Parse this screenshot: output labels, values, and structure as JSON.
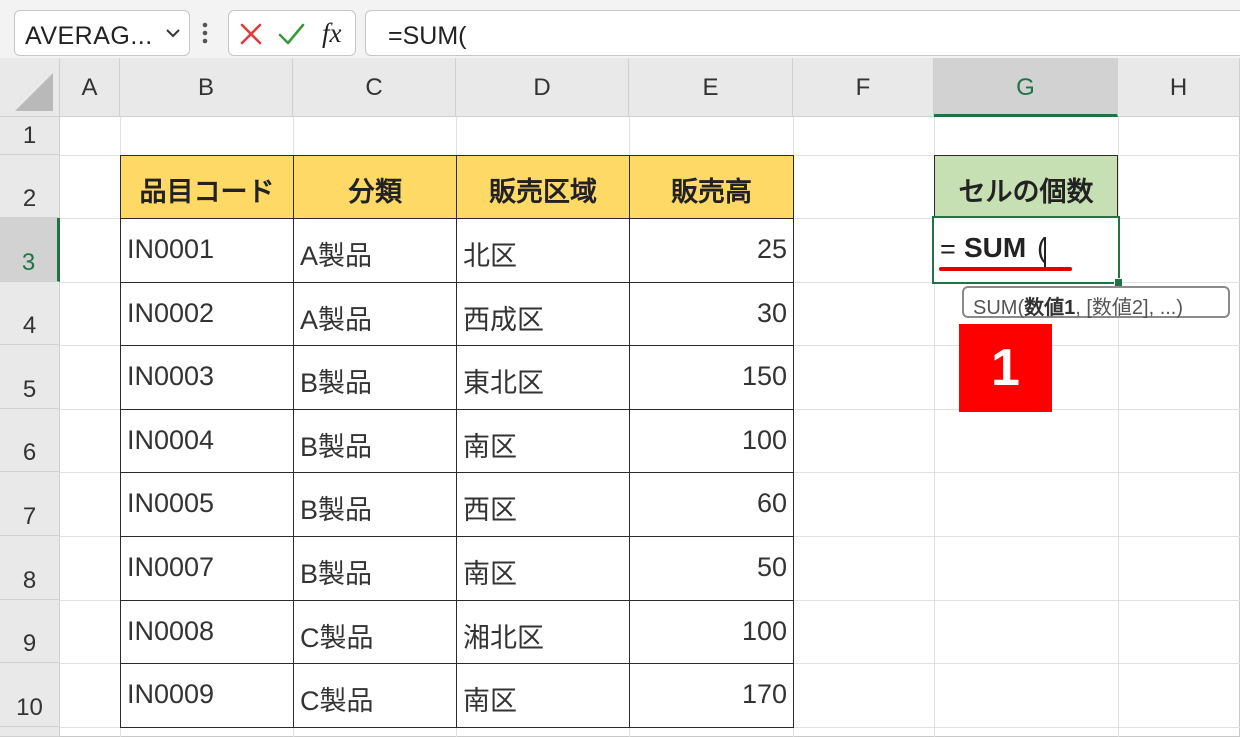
{
  "formula_bar": {
    "name_box": "AVERAG...",
    "icons": [
      "chevron-down-icon",
      "more-vertical-icon",
      "cancel-icon",
      "enter-check-icon",
      "insert-function-icon"
    ],
    "fx_label": "fx",
    "formula": "=SUM("
  },
  "columns": [
    "A",
    "B",
    "C",
    "D",
    "E",
    "F",
    "G",
    "H"
  ],
  "selected_column": "G",
  "rows": [
    "1",
    "2",
    "3",
    "4",
    "5",
    "6",
    "7",
    "8",
    "9",
    "10"
  ],
  "selected_row": "3",
  "table": {
    "headers": [
      "品目コード",
      "分類",
      "販売区域",
      "販売高"
    ],
    "rows": [
      [
        "IN0001",
        "A製品",
        "北区",
        "25"
      ],
      [
        "IN0002",
        "A製品",
        "西成区",
        "30"
      ],
      [
        "IN0003",
        "B製品",
        "東北区",
        "150"
      ],
      [
        "IN0004",
        "B製品",
        "南区",
        "100"
      ],
      [
        "IN0005",
        "B製品",
        "西区",
        "60"
      ],
      [
        "IN0007",
        "B製品",
        "南区",
        "50"
      ],
      [
        "IN0008",
        "C製品",
        "湘北区",
        "100"
      ],
      [
        "IN0009",
        "C製品",
        "南区",
        "170"
      ]
    ]
  },
  "count_header": "セルの個数",
  "active_cell": {
    "address": "G3",
    "eq": "=",
    "fn": "SUM",
    "paren": "("
  },
  "tooltip": {
    "fn": "SUM(",
    "arg1": "数値1",
    "rest": ", [数値2], ...)"
  },
  "step_badge": "1",
  "colors": {
    "header_fill": "#ffd966",
    "count_header_fill": "#c6e0b4",
    "accent_green": "#217346",
    "badge_red": "#ff0000",
    "underline_red": "#e00000"
  }
}
